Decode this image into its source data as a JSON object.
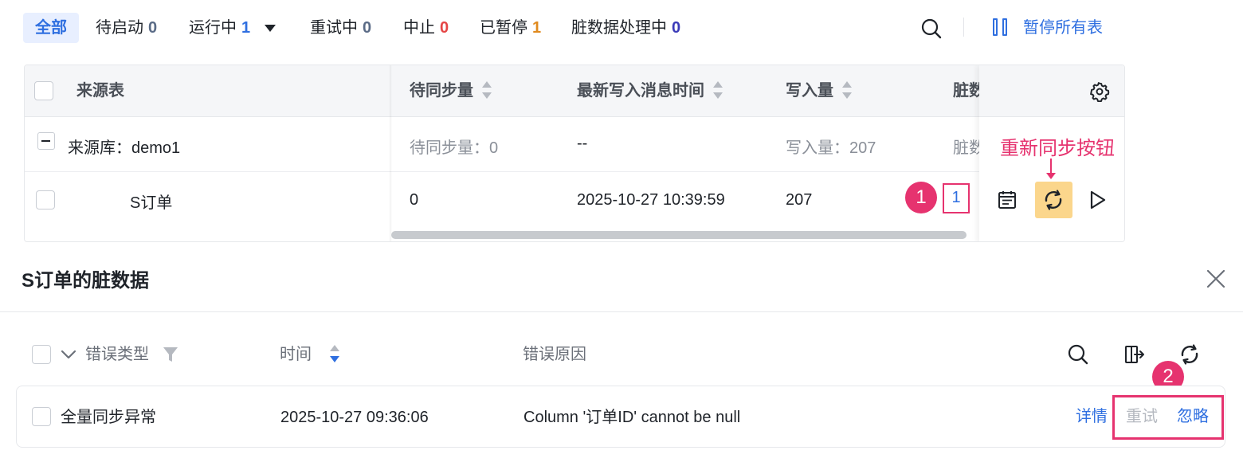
{
  "status_tabs": {
    "all": "全部",
    "pending": {
      "label": "待启动",
      "count": "0"
    },
    "running": {
      "label": "运行中",
      "count": "1"
    },
    "retrying": {
      "label": "重试中",
      "count": "0"
    },
    "stopped": {
      "label": "中止",
      "count": "0"
    },
    "paused": {
      "label": "已暂停",
      "count": "1"
    },
    "dirty": {
      "label": "脏数据处理中",
      "count": "0"
    }
  },
  "toolbar": {
    "pause_all_label": "暂停所有表"
  },
  "table": {
    "columns": {
      "source": "来源表",
      "pending_sync": "待同步量",
      "latest_msg_time": "最新写入消息时间",
      "write_count": "写入量",
      "dirty": "脏数"
    },
    "group_row": {
      "label": "来源库：demo1",
      "pending": "待同步量：0",
      "latest": "--",
      "write": "写入量：207",
      "dirty": "脏数"
    },
    "data_row": {
      "name": "S订单",
      "pending": "0",
      "latest": "2025-10-27 10:39:59",
      "write": "207",
      "dirty": "1"
    }
  },
  "annotations": {
    "badge1": "1",
    "badge2": "2",
    "resync_label": "重新同步按钮"
  },
  "dirty_panel": {
    "title": "S订单的脏数据",
    "columns": {
      "type": "错误类型",
      "time": "时间",
      "reason": "错误原因"
    },
    "rows": [
      {
        "type": "全量同步异常",
        "time": "2025-10-27 09:36:06",
        "reason": "Column '订单ID' cannot be null",
        "actions": {
          "detail": "详情",
          "retry": "重试",
          "ignore": "忽略"
        }
      }
    ]
  },
  "colors": {
    "accent": "#2f6fe0",
    "annotation": "#e6336f",
    "highlight": "#fbd68c",
    "running_count": "#2f6fe0",
    "stopped_count": "#e54545",
    "paused_count": "#e08a1e",
    "dirty_count": "#3a3ab8"
  }
}
